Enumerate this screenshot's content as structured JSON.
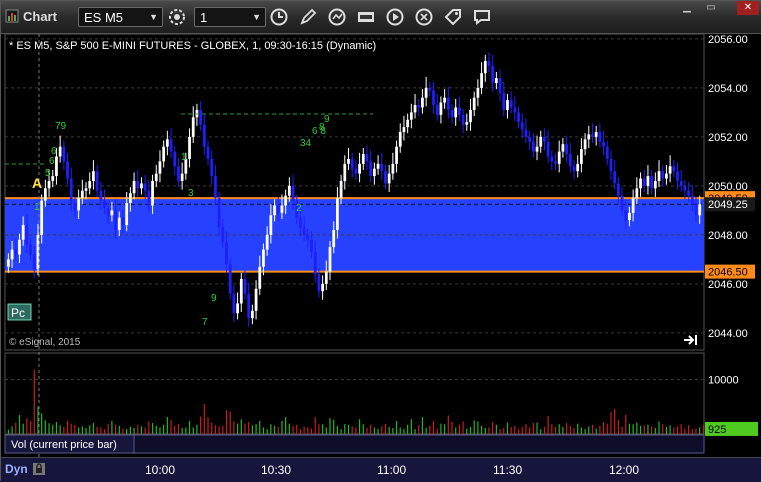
{
  "window": {
    "title": "Chart",
    "symbol": "ES M5",
    "interval": "1",
    "minimize": "▁",
    "maximize": "▭",
    "close": "✕"
  },
  "colors": {
    "up_bar": "#ffffff",
    "down_bar": "#1e1eff",
    "band": "#2642ff",
    "orange": "#ff8c1a",
    "grid": "#3a3a3a",
    "vol_up": "#22b822",
    "vol_down": "#c81e1e"
  },
  "chart": {
    "header": "* ES M5, S&P 500 E-MINI FUTURES - GLOBEX, 1, 09:30-16:15 (Dynamic)",
    "copyright": "© eSignal, 2015",
    "price_ticks": [
      "2056.00",
      "2054.00",
      "2052.00",
      "2050.00",
      "2048.00",
      "2046.00",
      "2044.00"
    ],
    "price_ticks_values": [
      2056,
      2054,
      2052,
      2050,
      2048,
      2046,
      2044
    ],
    "upper_band_label": "2049.50",
    "upper_band_value": 2049.5,
    "lower_band_label": "2046.50",
    "lower_band_value": 2046.5,
    "last_price_label": "2049.25",
    "last_price_value": 2049.25,
    "pc_button": "Pc",
    "marker_a": "A",
    "scroll_right_icon": "arrow-to-end-icon",
    "annotations": [
      {
        "text": "79"
      },
      {
        "text": "5"
      },
      {
        "text": "6"
      },
      {
        "text": "9"
      },
      {
        "text": "6 8"
      },
      {
        "text": "34"
      },
      {
        "text": "3"
      },
      {
        "text": "1"
      },
      {
        "text": "9"
      },
      {
        "text": "7"
      },
      {
        "text": "1"
      },
      {
        "text": "2"
      },
      {
        "text": "6"
      },
      {
        "text": "8"
      }
    ]
  },
  "volume": {
    "tick_label": "10000",
    "tick_value": 10000,
    "current_label": "925",
    "current_value": 925,
    "study_label": "Vol (current price bar)"
  },
  "footer": {
    "dyn": "Dyn",
    "times": [
      "10:00",
      "10:30",
      "11:00",
      "11:30",
      "12:00"
    ]
  },
  "chart_data": {
    "type": "candlestick",
    "title": "* ES M5, S&P 500 E-MINI FUTURES - GLOBEX, 1, 09:30-16:15 (Dynamic)",
    "interval_minutes": 1,
    "ylim": [
      2043.3,
      2056.2
    ],
    "x_tick_labels": [
      "10:00",
      "10:30",
      "11:00",
      "11:30",
      "12:00"
    ],
    "y_tick_labels": [
      "2044.00",
      "2046.00",
      "2048.00",
      "2050.00",
      "2052.00",
      "2054.00",
      "2056.00"
    ],
    "bars_close": [
      2047.0,
      2047.4,
      2047.2,
      2047.8,
      2048.4,
      2047.6,
      2047.2,
      2046.6,
      2048.0,
      2049.4,
      2049.9,
      2050.2,
      2050.4,
      2051.2,
      2051.6,
      2051.0,
      2050.3,
      2049.3,
      2049.0,
      2049.5,
      2049.8,
      2049.9,
      2050.2,
      2050.6,
      2049.8,
      2049.4,
      2049.1,
      2048.8,
      2049.0,
      2048.2,
      2048.7,
      2048.4,
      2049.3,
      2049.7,
      2050.2,
      2049.9,
      2050.1,
      2049.8,
      2049.2,
      2050.2,
      2050.5,
      2051.0,
      2051.6,
      2051.9,
      2051.4,
      2050.8,
      2050.2,
      2050.5,
      2051.1,
      2052.0,
      2052.8,
      2053.1,
      2052.5,
      2051.6,
      2051.1,
      2050.4,
      2049.5,
      2048.3,
      2047.7,
      2046.8,
      2045.6,
      2044.8,
      2045.2,
      2046.2,
      2045.6,
      2044.6,
      2044.9,
      2045.8,
      2046.7,
      2047.4,
      2048.0,
      2048.8,
      2049.2,
      2048.9,
      2049.2,
      2049.6,
      2050.0,
      2049.4,
      2048.7,
      2048.3,
      2048.0,
      2047.8,
      2047.3,
      2046.4,
      2045.7,
      2046.0,
      2046.5,
      2047.5,
      2048.2,
      2049.5,
      2050.2,
      2050.9,
      2051.1,
      2050.7,
      2050.5,
      2050.9,
      2051.3,
      2051.0,
      2050.4,
      2050.7,
      2050.9,
      2050.6,
      2050.1,
      2050.5,
      2050.9,
      2051.6,
      2052.2,
      2052.4,
      2052.7,
      2053.0,
      2053.3,
      2053.2,
      2053.6,
      2054.0,
      2053.9,
      2053.3,
      2052.9,
      2053.4,
      2053.6,
      2053.1,
      2052.8,
      2053.2,
      2052.9,
      2052.5,
      2052.6,
      2053.1,
      2053.6,
      2054.0,
      2054.6,
      2055.1,
      2054.9,
      2054.2,
      2054.4,
      2053.8,
      2053.1,
      2053.5,
      2053.2,
      2053.0,
      2052.6,
      2052.3,
      2052.0,
      2051.8,
      2051.4,
      2051.6,
      2052.0,
      2051.8,
      2051.2,
      2051.0,
      2050.9,
      2051.4,
      2051.7,
      2051.3,
      2050.8,
      2050.6,
      2050.9,
      2051.5,
      2051.9,
      2052.1,
      2052.0,
      2052.2,
      2051.8,
      2051.6,
      2051.1,
      2050.6,
      2050.1,
      2049.6,
      2049.0,
      2048.6,
      2048.9,
      2049.5,
      2049.9,
      2050.3,
      2050.0,
      2050.4,
      2049.9,
      2050.2,
      2050.6,
      2050.3,
      2050.5,
      2050.8,
      2050.6,
      2050.2,
      2050.0,
      2049.8,
      2049.6,
      2049.3,
      2048.8,
      2049.25
    ],
    "band": {
      "upper": 2049.5,
      "lower": 2046.5
    },
    "last": 2049.25,
    "volume_scale_max": 14500,
    "volume": [
      800,
      1400,
      2100,
      3500,
      1900,
      2900,
      2400,
      11800,
      5000,
      3800,
      2500,
      2000,
      1700,
      2200,
      1600,
      1300,
      2400,
      1900,
      1700,
      1200,
      1400,
      1100,
      1600,
      2000,
      1300,
      1200,
      900,
      1800,
      2400,
      1700,
      1500,
      1000,
      900,
      1300,
      1100,
      1600,
      1400,
      1200,
      2300,
      2000,
      1500,
      1200,
      1700,
      3100,
      2600,
      1500,
      1800,
      1100,
      1200,
      2400,
      1200,
      1700,
      3200,
      5500,
      3100,
      2100,
      1600,
      1400,
      1500,
      4400,
      4100,
      2300,
      1900,
      2700,
      1900,
      2200,
      1600,
      1800,
      2400,
      1200,
      900,
      1800,
      1500,
      1300,
      2400,
      3100,
      1900,
      1500,
      1700,
      900,
      1300,
      1200,
      1000,
      3100,
      1800,
      1800,
      1200,
      2900,
      2600,
      1500,
      900,
      1800,
      1700,
      1400,
      1200,
      2700,
      1800,
      1100,
      1700,
      1200,
      900,
      1400,
      1800,
      1300,
      1100,
      2400,
      1200,
      900,
      1700,
      2700,
      900,
      1600,
      3100,
      1100,
      1500,
      2400,
      1000,
      1900,
      1800,
      3400,
      2200,
      1200,
      1700,
      2300,
      1000,
      1300,
      2500,
      2300,
      1500,
      1100,
      1200,
      2200,
      1700,
      900,
      1100,
      2100,
      1300,
      1500,
      900,
      1300,
      1800,
      1200,
      2000,
      2100,
      900,
      1300,
      3300,
      1800,
      1300,
      1800,
      1300,
      2000,
      1500,
      1100,
      1900,
      1200,
      900,
      1400,
      1700,
      1000,
      1500,
      2200,
      1900,
      4000,
      4600,
      2600,
      1300,
      3500,
      1900,
      1800,
      2100,
      1500,
      1600,
      1700,
      1400,
      1100,
      2300,
      1800,
      1300,
      1600,
      1200,
      1400,
      1800,
      1000,
      1600,
      900,
      1000,
      1200,
      1500,
      925
    ]
  }
}
